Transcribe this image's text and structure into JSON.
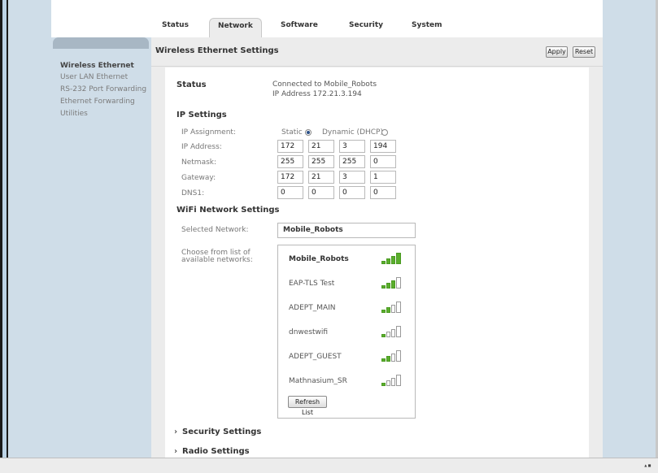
{
  "tabs": [
    {
      "label": "Status"
    },
    {
      "label": "Network"
    },
    {
      "label": "Software"
    },
    {
      "label": "Security"
    },
    {
      "label": "System"
    }
  ],
  "sidebar": {
    "items": [
      {
        "label": "Wireless Ethernet"
      },
      {
        "label": "User LAN Ethernet"
      },
      {
        "label": "RS-232 Port Forwarding"
      },
      {
        "label": "Ethernet Forwarding"
      },
      {
        "label": "Utilities"
      }
    ]
  },
  "header": {
    "title": "Wireless Ethernet Settings",
    "apply_label": "Apply",
    "reset_label": "Reset"
  },
  "status": {
    "label": "Status",
    "connected": "Connected to Mobile_Robots",
    "ip": "IP Address 172.21.3.194"
  },
  "ip_settings": {
    "heading": "IP Settings",
    "assignment_label": "IP Assignment:",
    "static_label": "Static",
    "dynamic_label": "Dynamic (DHCP)",
    "rows": [
      {
        "label": "IP Address:",
        "octets": [
          "172",
          "21",
          "3",
          "194"
        ]
      },
      {
        "label": "Netmask:",
        "octets": [
          "255",
          "255",
          "255",
          "0"
        ]
      },
      {
        "label": "Gateway:",
        "octets": [
          "172",
          "21",
          "3",
          "1"
        ]
      },
      {
        "label": "DNS1:",
        "octets": [
          "0",
          "0",
          "0",
          "0"
        ]
      }
    ]
  },
  "wifi": {
    "heading": "WiFi Network Settings",
    "selected_label": "Selected Network:",
    "selected_value": "Mobile_Robots",
    "choose_label_line1": "Choose from list of",
    "choose_label_line2": "available networks:",
    "networks": [
      {
        "name": "Mobile_Robots",
        "signal_bars": 4
      },
      {
        "name": "EAP-TLS Test",
        "signal_bars": 3
      },
      {
        "name": "ADEPT_MAIN",
        "signal_bars": 2
      },
      {
        "name": "dnwestwifi",
        "signal_bars": 1
      },
      {
        "name": "ADEPT_GUEST",
        "signal_bars": 2
      },
      {
        "name": "Mathnasium_SR",
        "signal_bars": 1
      }
    ],
    "refresh_label": "Refresh List"
  },
  "sections": {
    "security_label": "Security Settings",
    "radio_label": "Radio Settings"
  },
  "colors": {
    "sidebar_bg": "#cfdde8",
    "signal_on": "#5aae2c"
  }
}
